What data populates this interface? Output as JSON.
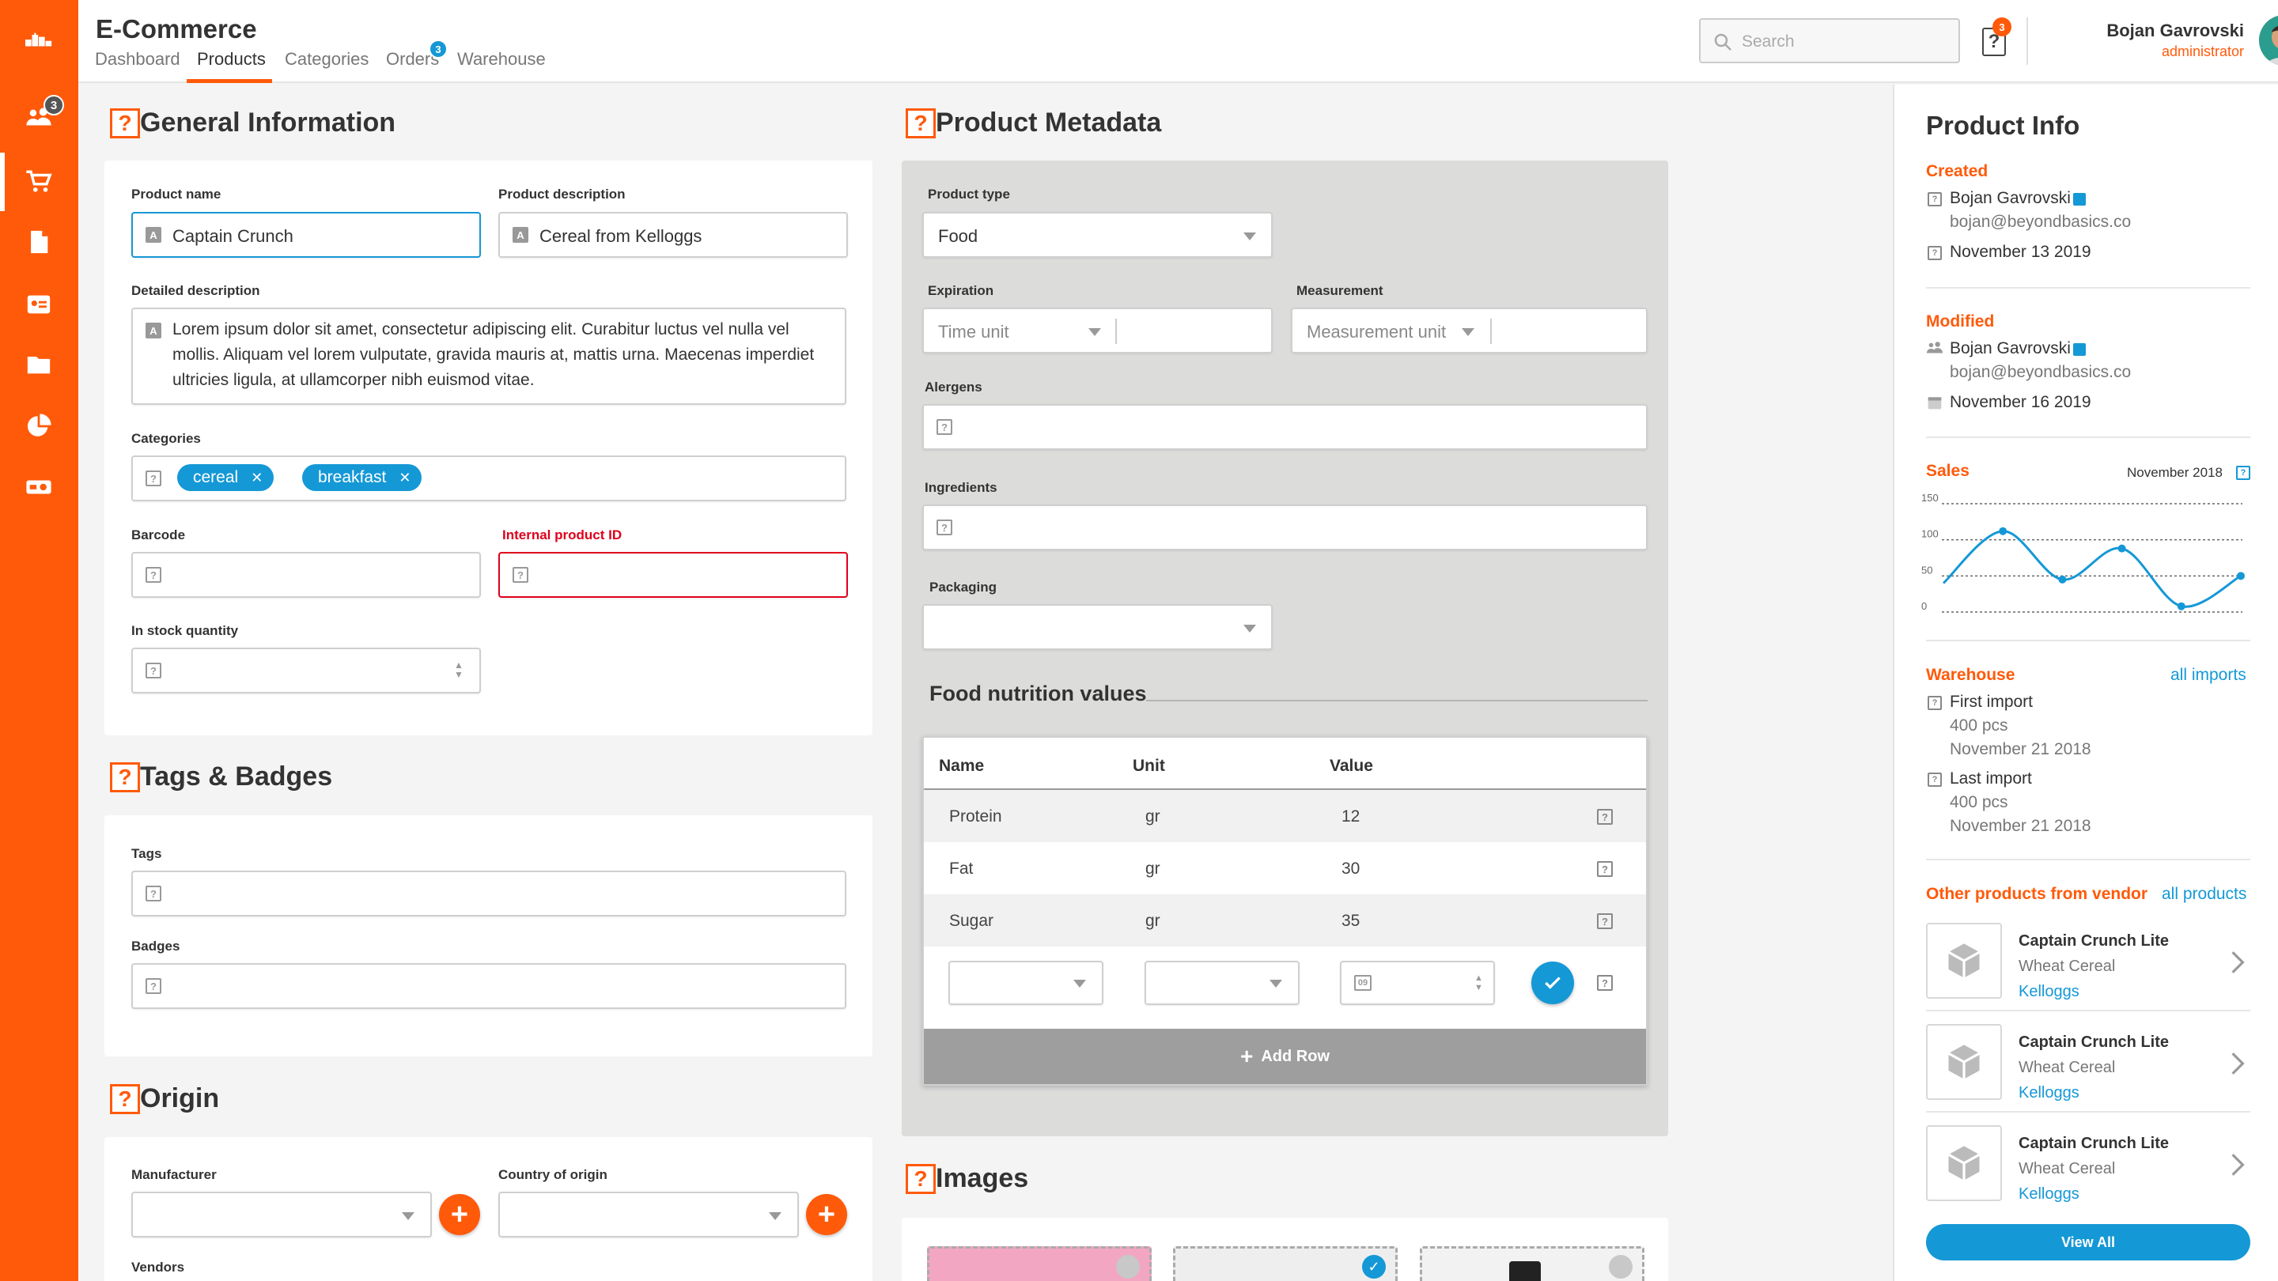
{
  "sidebar": {
    "users_badge": "3",
    "accent": "#ff5a0a"
  },
  "header": {
    "title": "E-Commerce",
    "tabs": [
      "Dashboard",
      "Products",
      "Categories",
      "Orders",
      "Warehouse"
    ],
    "orders_badge": "3",
    "search_placeholder": "Search",
    "help_badge": "3",
    "user_name": "Bojan Gavrovski",
    "user_role": "administrator"
  },
  "general": {
    "title": "General Information",
    "product_name_label": "Product name",
    "product_name_value": "Captain Crunch",
    "product_desc_label": "Product description",
    "product_desc_value": "Cereal from Kelloggs",
    "detailed_label": "Detailed description",
    "detailed_line1": "Lorem ipsum dolor sit amet, consectetur adipiscing elit. Curabitur luctus vel nulla vel",
    "detailed_line2": "mollis. Aliquam vel lorem vulputate, gravida mauris at, mattis urna. Maecenas imperdiet",
    "detailed_line3": "ultricies ligula, at ullamcorper nibh euismod vitae.",
    "categories_label": "Categories",
    "categories": [
      "cereal",
      "breakfast"
    ],
    "barcode_label": "Barcode",
    "internal_id_label": "Internal product ID",
    "stock_label": "In stock quantity"
  },
  "tags": {
    "title": "Tags & Badges",
    "tags_label": "Tags",
    "badges_label": "Badges"
  },
  "origin": {
    "title": "Origin",
    "manufacturer_label": "Manufacturer",
    "country_label": "Country of origin",
    "vendors_label": "Vendors"
  },
  "meta": {
    "title": "Product Metadata",
    "product_type_label": "Product type",
    "product_type_value": "Food",
    "expiration_label": "Expiration",
    "time_unit_placeholder": "Time unit",
    "measurement_label": "Measurement",
    "measurement_placeholder": "Measurement unit",
    "allergens_label": "Alergens",
    "ingredients_label": "Ingredients",
    "packaging_label": "Packaging",
    "nutrition_title": "Food nutrition values",
    "columns": [
      "Name",
      "Unit",
      "Value"
    ],
    "rows": [
      {
        "name": "Protein",
        "unit": "gr",
        "value": "12"
      },
      {
        "name": "Fat",
        "unit": "gr",
        "value": "30"
      },
      {
        "name": "Sugar",
        "unit": "gr",
        "value": "35"
      }
    ],
    "number_placeholder": "09",
    "add_row_label": "Add Row"
  },
  "images": {
    "title": "Images"
  },
  "info": {
    "title": "Product Info",
    "created_label": "Created",
    "created_by": "Bojan Gavrovski",
    "created_email": "bojan@beyondbasics.co",
    "created_date": "November 13 2019",
    "modified_label": "Modified",
    "modified_by": "Bojan Gavrovski",
    "modified_email": "bojan@beyondbasics.co",
    "modified_date": "November 16 2019",
    "sales_label": "Sales",
    "sales_period": "November 2018",
    "warehouse_label": "Warehouse",
    "all_imports": "all imports",
    "first_import_label": "First import",
    "first_import_qty": "400 pcs",
    "first_import_date": "November 21 2018",
    "last_import_label": "Last import",
    "last_import_qty": "400 pcs",
    "last_import_date": "November 21 2018",
    "vendor_label": "Other products from vendor",
    "all_products": "all products",
    "vendor_products": [
      {
        "name": "Captain Crunch Lite",
        "category": "Wheat Cereal",
        "vendor": "Kelloggs"
      },
      {
        "name": "Captain Crunch Lite",
        "category": "Wheat Cereal",
        "vendor": "Kelloggs"
      },
      {
        "name": "Captain Crunch Lite",
        "category": "Wheat Cereal",
        "vendor": "Kelloggs"
      }
    ],
    "view_all": "View All"
  },
  "chart_data": {
    "type": "line",
    "title": "",
    "xlabel": "",
    "ylabel": "",
    "yticks": [
      "150",
      "100",
      "50",
      "0"
    ],
    "ylim": [
      0,
      150
    ],
    "x": [
      0,
      1,
      2,
      3,
      4,
      5
    ],
    "values": [
      40,
      112,
      45,
      88,
      8,
      50
    ],
    "series_color": "#1598d6",
    "grid": "dashed horizontal"
  }
}
